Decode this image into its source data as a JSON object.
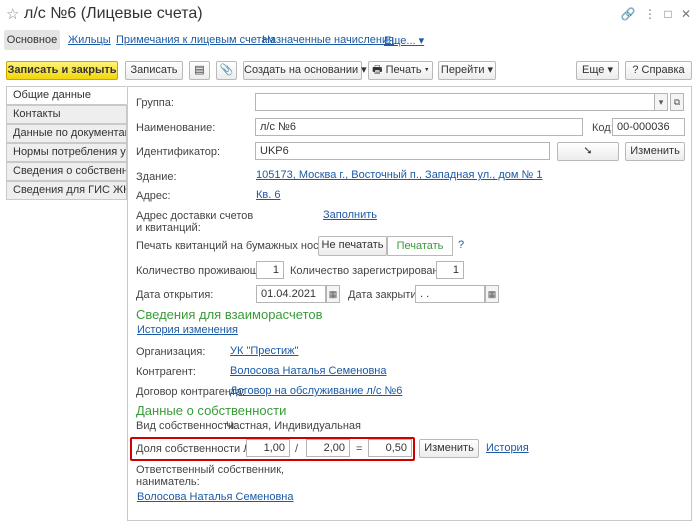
{
  "window": {
    "title": "л/с №6 (Лицевые счета)"
  },
  "nav_tabs": [
    "Основное",
    "Жильцы",
    "Примечания к лицевым счетам",
    "Назначенные начисления",
    "Еще..."
  ],
  "toolbar": {
    "save_close": "Записать и закрыть",
    "save": "Записать",
    "create_based": "Создать на основании",
    "print": "Печать",
    "goto": "Перейти",
    "more": "Еще",
    "help": "Справка"
  },
  "side_items": [
    "Общие данные",
    "Контакты",
    "Данные по документам",
    "Нормы потребления услуг",
    "Сведения о собственнике",
    "Сведения для ГИС ЖКХ"
  ],
  "form": {
    "group_label": "Группа:",
    "name_label": "Наименование:",
    "name_value": "л/с №6",
    "code_label": "Код:",
    "code_value": "00-000036",
    "ident_label": "Идентификатор:",
    "ident_value": "UKP6",
    "change_btn": "Изменить",
    "building_label": "Здание:",
    "building_value": "105173, Москва г., Восточный п., Западная ул., дом № 1",
    "address_label": "Адрес:",
    "address_value": "Кв. 6",
    "delivery_label_1": "Адрес доставки счетов",
    "delivery_label_2": "и квитанций:",
    "fill_link": "Заполнить",
    "print_paper_label": "Печать квитанций на бумажных носителях:",
    "no_print": "Не печатать",
    "do_print": "Печатать",
    "help_q": "?",
    "residents_label": "Количество проживающих:",
    "residents_value": "1",
    "registered_label": "Количество зарегистрированных:",
    "registered_value": "1",
    "open_date_label": "Дата открытия:",
    "open_date_value": "01.04.2021",
    "close_date_label": "Дата закрытия:",
    "close_date_value": " .  ."
  },
  "settlements": {
    "header": "Сведения для взаиморасчетов",
    "history_link": "История изменения",
    "org_label": "Организация:",
    "org_value": "УК \"Престиж\"",
    "counterparty_label": "Контрагент:",
    "counterparty_value": "Волосова Наталья Семеновна",
    "contract_label": "Договор контрагента:",
    "contract_value": "Договор на обслуживание л/с №6"
  },
  "ownership": {
    "header": "Данные о собственности",
    "kind_label": "Вид собственности:",
    "kind_value": "Частная, Индивидуальная",
    "share_label": "Доля собственности Л/С:",
    "share_num": "1,00",
    "slash": "/",
    "share_den": "2,00",
    "equals": "=",
    "share_result": "0,50",
    "change_btn": "Изменить",
    "history_link": "История",
    "resp_label_1": "Ответственный собственник,",
    "resp_label_2": "наниматель:",
    "resp_value": "Волосова Наталья Семеновна"
  }
}
